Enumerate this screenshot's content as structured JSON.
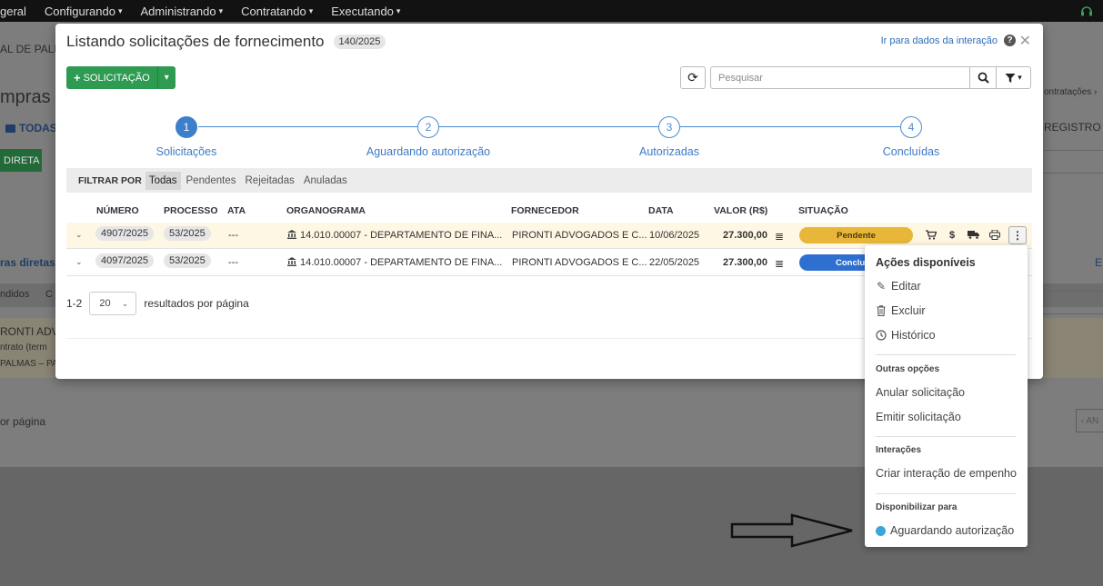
{
  "topnav": {
    "items": [
      "geral",
      "Configurando",
      "Administrando",
      "Contratando",
      "Executando"
    ],
    "caret": "▾",
    "support_icon": "support-icon"
  },
  "background": {
    "entity_partial": "AL DE PALM",
    "section_partial": "mpras d",
    "folder_tab": "TODAS",
    "direct_button": "DIRETA",
    "breadcrumb_partial": "ontratações ›",
    "registro_partial": "REGISTRO D",
    "list_title_partial": "ras diretas",
    "list_right_partial": "E",
    "subtab_partial": "ndidos",
    "subtab_partial2": "C",
    "supplier_partial": "RONTI ADVO",
    "contract_partial": "ntrato (term",
    "location_partial": "PALMAS – PA",
    "per_page_partial": "or página",
    "pager_back_partial": "‹ AN"
  },
  "modal": {
    "title": "Listando solicitações de fornecimento",
    "ref_badge": "140/2025",
    "link_interaction": "Ir para dados da interação",
    "help": "?",
    "close": "✕",
    "new_button": "SOLICITAÇÃO",
    "new_button_plus": "+",
    "new_caret": "▾",
    "search_placeholder": "Pesquisar",
    "refresh_icon": "⟳"
  },
  "steps": [
    {
      "number": "1",
      "label": "Solicitações",
      "active": true
    },
    {
      "number": "2",
      "label": "Aguardando autorização",
      "active": false
    },
    {
      "number": "3",
      "label": "Autorizadas",
      "active": false
    },
    {
      "number": "4",
      "label": "Concluídas",
      "active": false
    }
  ],
  "filter": {
    "label": "FILTRAR POR",
    "options": [
      "Todas",
      "Pendentes",
      "Rejeitadas",
      "Anuladas"
    ],
    "selected": "Todas"
  },
  "table": {
    "headers": [
      "NÚMERO",
      "PROCESSO",
      "ATA",
      "ORGANOGRAMA",
      "FORNECEDOR",
      "DATA",
      "VALOR (R$)",
      "SITUAÇÃO"
    ],
    "rows": [
      {
        "numero": "4907/2025",
        "processo": "53/2025",
        "ata": "---",
        "organograma": "14.010.00007 - DEPARTAMENTO DE FINA...",
        "fornecedor": "PIRONTI ADVOGADOS E C...",
        "data": "10/06/2025",
        "valor": "27.300,00",
        "situacao": "Pendente"
      },
      {
        "numero": "4097/2025",
        "processo": "53/2025",
        "ata": "---",
        "organograma": "14.010.00007 - DEPARTAMENTO DE FINA...",
        "fornecedor": "PIRONTI ADVOGADOS E C...",
        "data": "22/05/2025",
        "valor": "27.300,00",
        "situacao": "Concluí"
      }
    ]
  },
  "pagination": {
    "range": "1-2",
    "per_page": "20",
    "per_page_label": "resultados por página"
  },
  "menu": {
    "title": "Ações disponíveis",
    "items": [
      "Editar",
      "Excluir",
      "Histórico"
    ],
    "section_outras": "Outras opções",
    "outras_items": [
      "Anular solicitação",
      "Emitir solicitação"
    ],
    "section_interacoes": "Interações",
    "interacoes_items": [
      "Criar interação de empenho"
    ],
    "section_disponibilizar": "Disponibilizar para",
    "disponibilizar_items": [
      "Aguardando autorização"
    ]
  },
  "colors": {
    "primary_blue": "#3e7fcb",
    "green": "#2e9a52",
    "pending_yellow": "#e8b73a",
    "done_blue": "#2f6fd0",
    "dot_blue": "#3aa6d9"
  }
}
